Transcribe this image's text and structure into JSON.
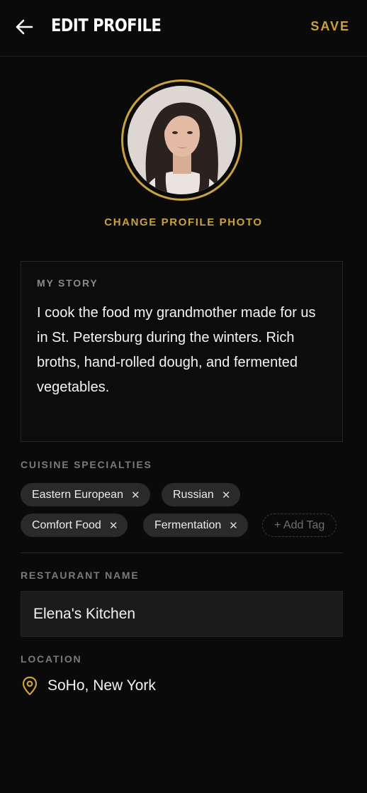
{
  "header": {
    "title": "EDIT PROFILE",
    "save_label": "SAVE"
  },
  "profile": {
    "change_photo_label": "CHANGE PROFILE PHOTO"
  },
  "story": {
    "label": "MY STORY",
    "text": "I cook the food my grandmother made for us in St. Petersburg during the winters. Rich broths, hand-rolled dough, and fermented vegetables."
  },
  "cuisine": {
    "label": "CUISINE SPECIALTIES",
    "tags": [
      {
        "label": "Eastern European"
      },
      {
        "label": "Russian"
      },
      {
        "label": "Comfort Food"
      },
      {
        "label": "Fermentation"
      }
    ],
    "add_tag_label": "+ Add Tag",
    "remove_glyph": "✕"
  },
  "restaurant": {
    "label": "RESTAURANT NAME",
    "value": "Elena's Kitchen"
  },
  "location": {
    "label": "LOCATION",
    "value": "SoHo, New York",
    "icon": "map-pin-icon"
  },
  "colors": {
    "accent": "#c9a23f",
    "background": "#0a0a0a",
    "tag_bg": "#2a2a2a"
  }
}
